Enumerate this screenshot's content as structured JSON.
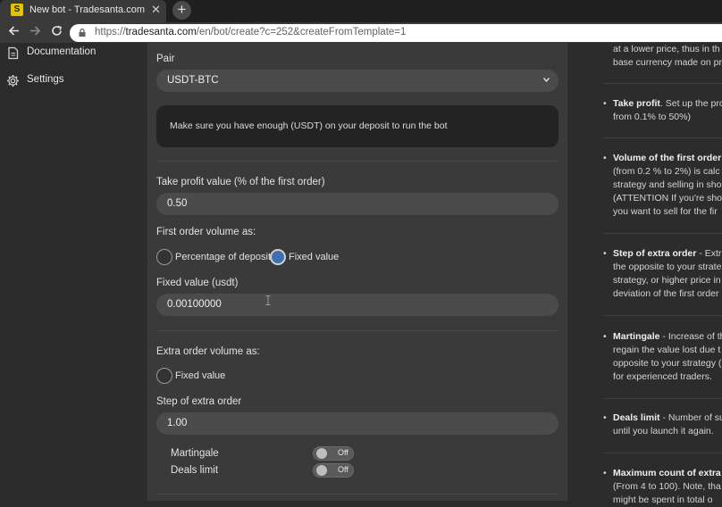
{
  "browser": {
    "tab_title": "New bot - Tradesanta.com",
    "tab_close": "✕",
    "new_tab": "+",
    "url_prefix": "https://",
    "url_host": "tradesanta.com",
    "url_path": "/en/bot/create?c=252&createFromTemplate=1"
  },
  "sidebar": {
    "items": [
      {
        "label": "Documentation",
        "icon": "document-icon"
      },
      {
        "label": "Settings",
        "icon": "gear-icon"
      }
    ]
  },
  "form": {
    "pair_label": "Pair",
    "pair_value": "USDT-BTC",
    "notice": "Make sure you have enough (USDT) on your deposit to run the bot",
    "take_profit_label": "Take profit value (% of the first order)",
    "take_profit_value": "0.50",
    "first_order_label": "First order volume as:",
    "first_order_options": [
      "Percentage of deposit",
      "Fixed value"
    ],
    "first_order_selected": "Fixed value",
    "fixed_value_label": "Fixed value (usdt)",
    "fixed_value_value": "0.00100000",
    "extra_order_label": "Extra order volume as:",
    "extra_order_option": "Fixed value",
    "step_label": "Step of extra order",
    "step_value": "1.00",
    "martingale_label": "Martingale",
    "martingale_state": "Off",
    "deals_limit_label": "Deals limit",
    "deals_limit_state": "Off"
  },
  "help": {
    "intro_line1": "at a lower price, thus in th",
    "intro_line2": "base currency made on pr",
    "take_profit_title": "Take profit",
    "take_profit_line1": ". Set up the pro",
    "take_profit_line2": "from 0.1% to 50%)",
    "volume_title": "Volume of the first order",
    "volume_line1": "(from 0.2 % to 2%) is calc",
    "volume_line2": "strategy and selling in sho",
    "volume_line3": "(ATTENTION If you're shor",
    "volume_line4": "you want to sell for the fir",
    "step_title": "Step of extra order",
    "step_line1": " - Extr",
    "step_line2": "the opposite to your strate",
    "step_line3": "strategy, or higher price in",
    "step_line4": "deviation of the first order",
    "martingale_title": "Martingale",
    "martingale_line1": " - Increase of th",
    "martingale_line2": "regain the value lost due t",
    "martingale_line3": "opposite to your strategy (",
    "martingale_line4": "for experienced traders.",
    "deals_title": "Deals limit",
    "deals_line1": " - Number of su",
    "deals_line2": "until you launch it again.",
    "max_title": "Maximum count of extra",
    "max_line2": "(From 4 to 100). Note, tha",
    "max_line3": "might be spent in total o"
  },
  "colors": {
    "accent_radio": "#3f6fb0",
    "panel": "#3a3a3a",
    "field": "#4b4b4b"
  }
}
